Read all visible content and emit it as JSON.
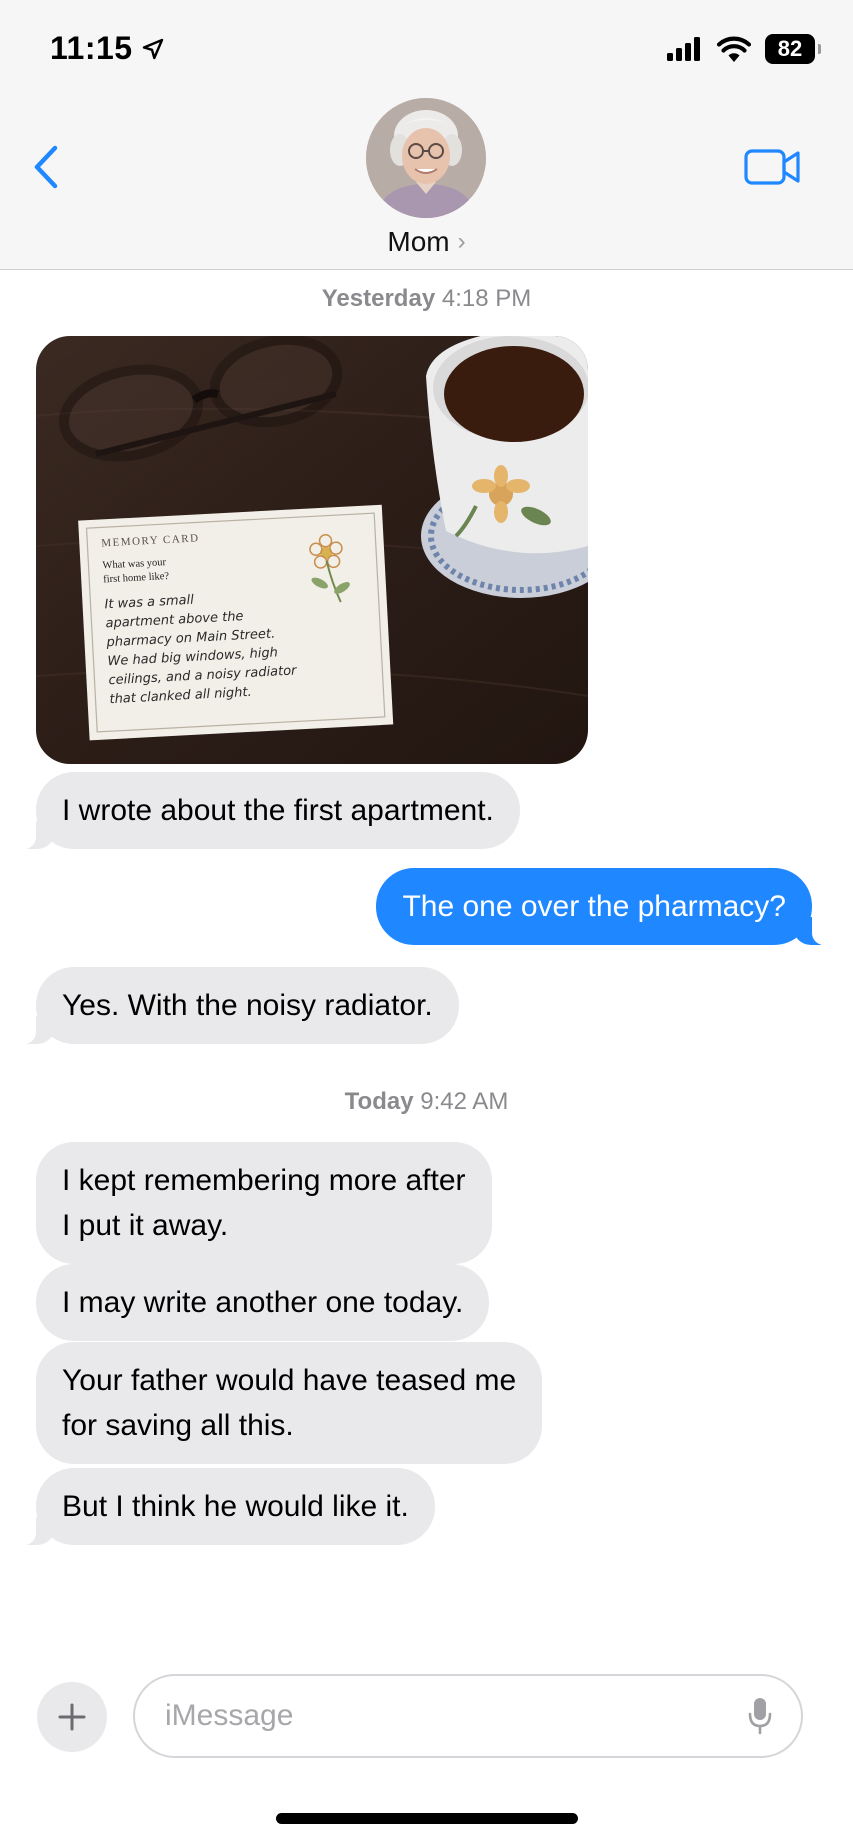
{
  "status_bar": {
    "time": "11:15",
    "battery": "82",
    "icons": [
      "location-arrow-icon",
      "cellular-signal-icon",
      "wifi-icon",
      "battery-icon"
    ]
  },
  "header": {
    "contact_name": "Mom",
    "name_chevron": "›",
    "back_icon": "chevron-left-icon",
    "video_icon": "video-camera-icon",
    "accent_color": "#1f87ff"
  },
  "timestamps": [
    {
      "day": "Yesterday",
      "time": "4:18 PM"
    },
    {
      "day": "Today",
      "time": "9:42 AM"
    }
  ],
  "photo": {
    "card_heading": "MEMORY CARD",
    "card_prompt": [
      "What was your",
      "first home like?"
    ],
    "card_handwriting": [
      "It was a small",
      "apartment above the",
      "pharmacy on Main Street.",
      "We had big windows, high",
      "ceilings, and a noisy radiator",
      "that clanked all night."
    ]
  },
  "messages": [
    {
      "direction": "incoming",
      "text": "I wrote about the first apartment."
    },
    {
      "direction": "outgoing",
      "text": "The one over the pharmacy?"
    },
    {
      "direction": "incoming",
      "text": "Yes. With the noisy radiator."
    },
    {
      "direction": "incoming",
      "text": "I kept remembering more after\nI put it away."
    },
    {
      "direction": "incoming",
      "text": "I may write another one today."
    },
    {
      "direction": "incoming",
      "text": "Your father would have teased me\nfor saving all this."
    },
    {
      "direction": "incoming",
      "text": "But I think he would like it."
    }
  ],
  "composer": {
    "placeholder": "iMessage",
    "plus_icon": "plus-icon",
    "mic_icon": "microphone-icon"
  },
  "colors": {
    "incoming_bubble": "#e9e9eb",
    "outgoing_bubble": "#1f87ff",
    "timestamp": "#8a8a8e"
  }
}
